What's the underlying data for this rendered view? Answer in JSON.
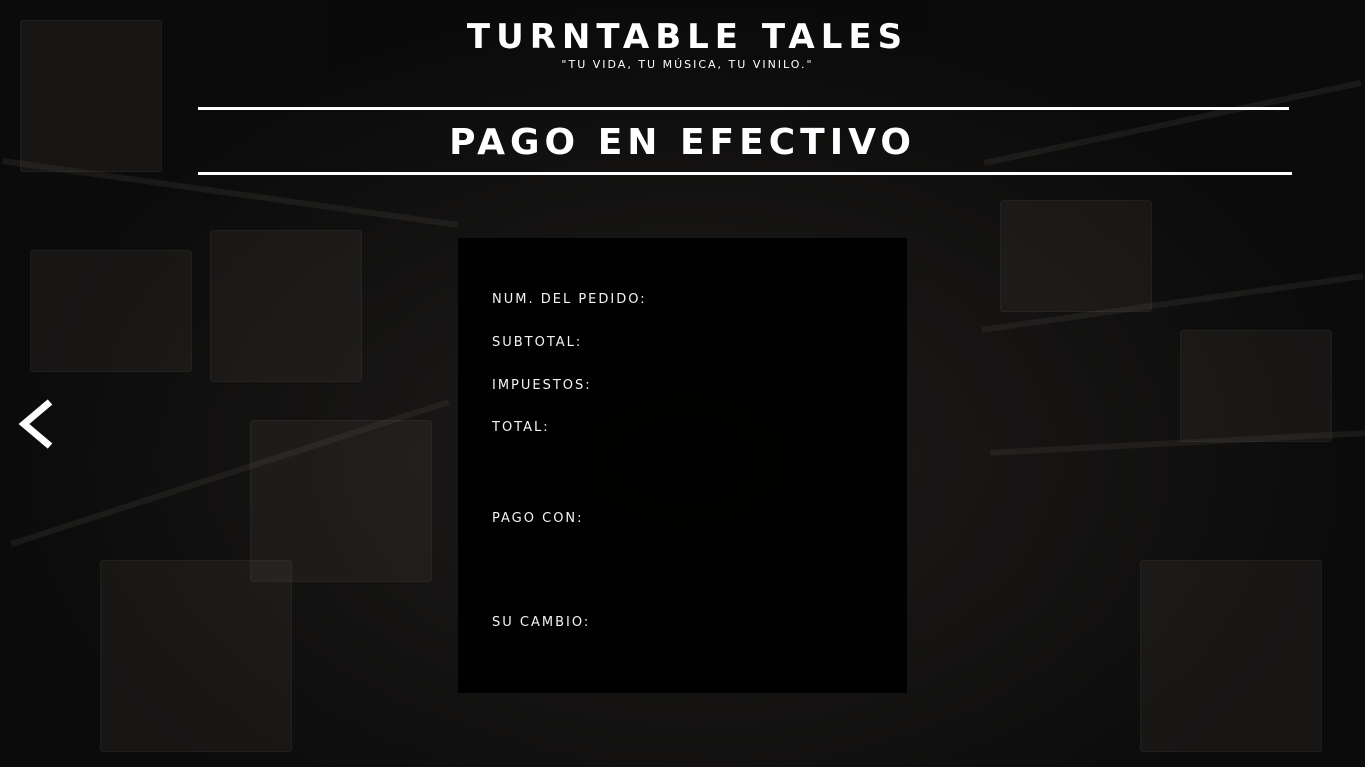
{
  "header": {
    "title": "TURNTABLE TALES",
    "tagline": "\"TU VIDA, TU MÚSICA, TU VINILO.\""
  },
  "page": {
    "title": "PAGO EN EFECTIVO"
  },
  "payment_summary": {
    "order_number_label": "NUM. DEL PEDIDO:",
    "subtotal_label": "SUBTOTAL:",
    "taxes_label": "IMPUESTOS:",
    "total_label": "TOTAL:",
    "paid_with_label": "PAGO CON:",
    "change_label": "SU CAMBIO:"
  },
  "navigation": {
    "back_icon": "chevron-left-icon"
  },
  "colors": {
    "text": "#ffffff",
    "panel": "#000000",
    "background": "#141414"
  }
}
